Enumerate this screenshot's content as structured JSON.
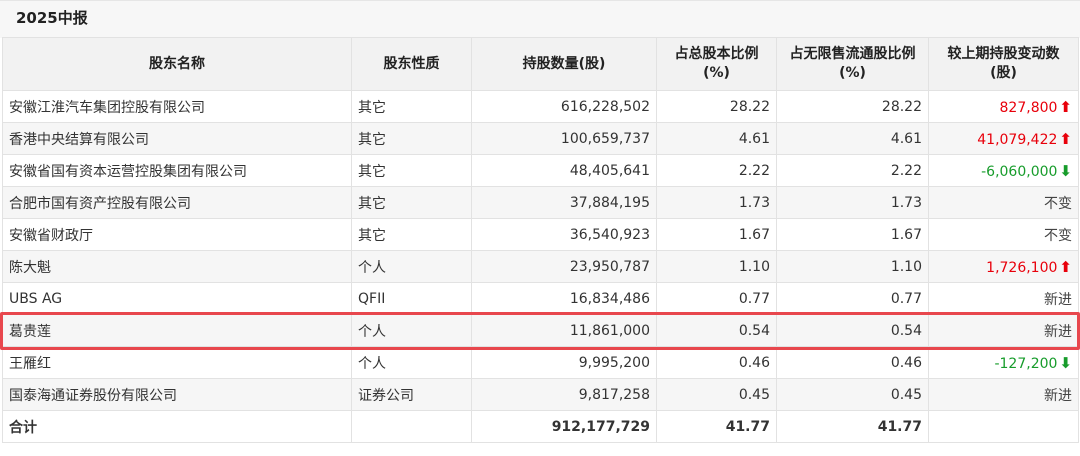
{
  "section_title": "2025中报",
  "columns": [
    "股东名称",
    "股东性质",
    "持股数量(股)",
    "占总股本比例(%)",
    "占无限售流通股比例(%)",
    "较上期持股变动数(股)"
  ],
  "rows": [
    {
      "name": "安徽江淮汽车集团控股有限公司",
      "type": "其它",
      "shares": "616,228,502",
      "pct_total": "28.22",
      "pct_float": "28.22",
      "change": "827,800",
      "trend": "up"
    },
    {
      "name": "香港中央结算有限公司",
      "type": "其它",
      "shares": "100,659,737",
      "pct_total": "4.61",
      "pct_float": "4.61",
      "change": "41,079,422",
      "trend": "up"
    },
    {
      "name": "安徽省国有资本运营控股集团有限公司",
      "type": "其它",
      "shares": "48,405,641",
      "pct_total": "2.22",
      "pct_float": "2.22",
      "change": "-6,060,000",
      "trend": "down"
    },
    {
      "name": "合肥市国有资产控股有限公司",
      "type": "其它",
      "shares": "37,884,195",
      "pct_total": "1.73",
      "pct_float": "1.73",
      "change": "不变",
      "trend": "flat"
    },
    {
      "name": "安徽省财政厅",
      "type": "其它",
      "shares": "36,540,923",
      "pct_total": "1.67",
      "pct_float": "1.67",
      "change": "不变",
      "trend": "flat"
    },
    {
      "name": "陈大魁",
      "type": "个人",
      "shares": "23,950,787",
      "pct_total": "1.10",
      "pct_float": "1.10",
      "change": "1,726,100",
      "trend": "up"
    },
    {
      "name": "UBS AG",
      "type": "QFII",
      "shares": "16,834,486",
      "pct_total": "0.77",
      "pct_float": "0.77",
      "change": "新进",
      "trend": "flat"
    },
    {
      "name": "葛贵莲",
      "type": "个人",
      "shares": "11,861,000",
      "pct_total": "0.54",
      "pct_float": "0.54",
      "change": "新进",
      "trend": "flat"
    },
    {
      "name": "王雁红",
      "type": "个人",
      "shares": "9,995,200",
      "pct_total": "0.46",
      "pct_float": "0.46",
      "change": "-127,200",
      "trend": "down"
    },
    {
      "name": "国泰海通证券股份有限公司",
      "type": "证券公司",
      "shares": "9,817,258",
      "pct_total": "0.45",
      "pct_float": "0.45",
      "change": "新进",
      "trend": "flat"
    }
  ],
  "total": {
    "label": "合计",
    "shares": "912,177,729",
    "pct_total": "41.77",
    "pct_float": "41.77"
  },
  "colors": {
    "up": "#e8000b",
    "down": "#179c2b",
    "highlight": "#e8474d"
  },
  "icons": {
    "up": "arrow-up-icon",
    "down": "arrow-down-icon"
  }
}
